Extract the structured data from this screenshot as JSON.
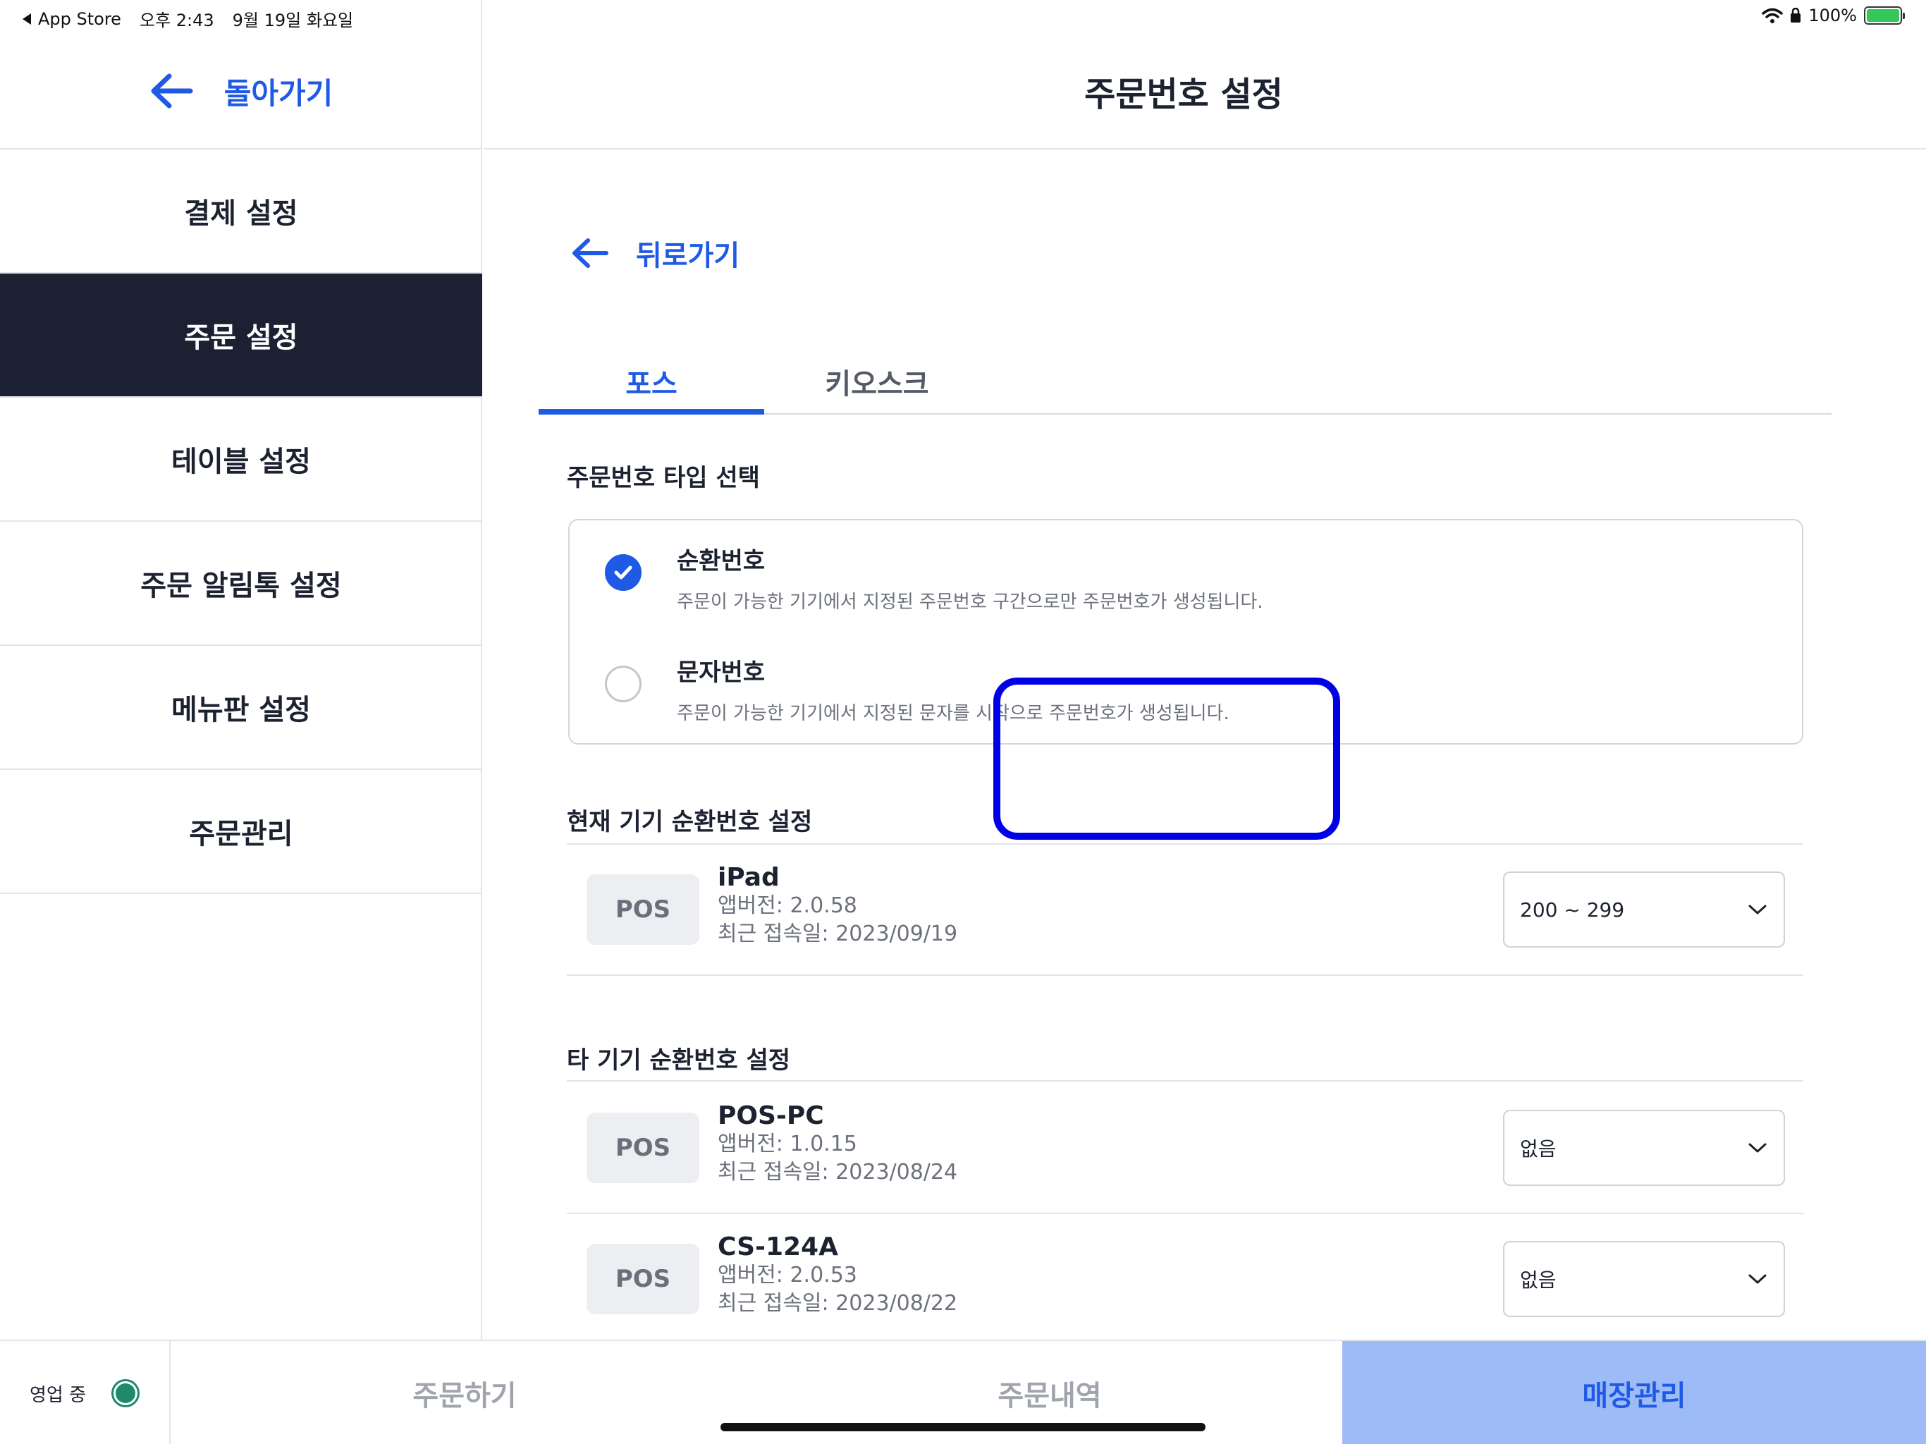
{
  "status_bar": {
    "back_app": "App Store",
    "time": "오후 2:43",
    "date": "9월 19일 화요일",
    "battery": "100%"
  },
  "sidebar": {
    "back_label": "돌아가기",
    "items": [
      {
        "label": "결제 설정"
      },
      {
        "label": "주문 설정"
      },
      {
        "label": "테이블 설정"
      },
      {
        "label": "주문 알림톡 설정"
      },
      {
        "label": "메뉴판 설정"
      },
      {
        "label": "주문관리"
      }
    ],
    "active_index": 1
  },
  "header": {
    "title": "주문번호 설정"
  },
  "main": {
    "back_label": "뒤로가기",
    "tabs": [
      {
        "label": "포스"
      },
      {
        "label": "키오스크"
      }
    ],
    "active_tab": 0,
    "type_section": {
      "title": "주문번호 타입 선택",
      "options": [
        {
          "title": "순환번호",
          "desc": "주문이 가능한 기기에서 지정된 주문번호 구간으로만 주문번호가 생성됩니다.",
          "checked": true
        },
        {
          "title": "문자번호",
          "desc": "주문이 가능한 기기에서 지정된 문자를 시작으로 주문번호가 생성됩니다.",
          "checked": false
        }
      ]
    },
    "current_device_section": {
      "title": "현재 기기 순환번호 설정",
      "device": {
        "badge": "POS",
        "name": "iPad",
        "version": "앱버전: 2.0.58",
        "last_access": "최근 접속일: 2023/09/19",
        "range": "200 ~ 299"
      }
    },
    "other_devices_section": {
      "title": "타 기기 순환번호 설정",
      "devices": [
        {
          "badge": "POS",
          "name": "POS-PC",
          "version": "앱버전: 1.0.15",
          "last_access": "최근 접속일: 2023/08/24",
          "range": "없음"
        },
        {
          "badge": "POS",
          "name": "CS-124A",
          "version": "앱버전: 2.0.53",
          "last_access": "최근 접속일: 2023/08/22",
          "range": "없음"
        }
      ]
    }
  },
  "bottom_bar": {
    "store_status": "영업 중",
    "tabs": [
      {
        "label": "주문하기"
      },
      {
        "label": "주문내역"
      },
      {
        "label": "매장관리"
      }
    ],
    "active_tab": 2
  },
  "colors": {
    "accent": "#1f5ae6",
    "sidebar_active_bg": "#1b2033",
    "bottom_active_bg": "#9dbcf7",
    "status_green": "#1d8a6b",
    "highlight": "#0000e6"
  }
}
